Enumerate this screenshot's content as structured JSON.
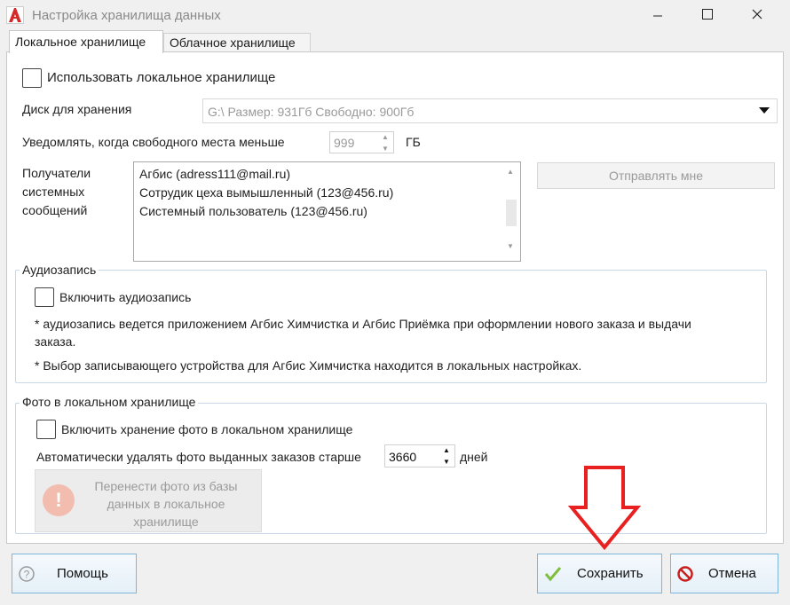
{
  "window": {
    "title": "Настройка хранилища данных",
    "app_icon": "agbis-logo-icon",
    "controls": {
      "minimize": "minimize-icon",
      "maximize": "maximize-icon",
      "close": "close-icon"
    }
  },
  "tabs": [
    {
      "label": "Локальное хранилище",
      "active": true
    },
    {
      "label": "Облачное хранилище",
      "active": false
    }
  ],
  "local": {
    "use_local_label": "Использовать локальное хранилище",
    "use_local_checked": false,
    "disk_label": "Диск для хранения",
    "disk_value": "G:\\ Размер: 931Гб Свободно: 900Гб",
    "notify_label": "Уведомлять, когда свободного места меньше",
    "notify_value": "999",
    "notify_unit": "ГБ",
    "recipients_label_1": "Получатели",
    "recipients_label_2": "системных",
    "recipients_label_3": "сообщений",
    "recipients": [
      "Агбис (adress111@mail.ru)",
      "Сотрудик цеха вымышленный (123@456.ru)",
      "Системный пользователь (123@456.ru)"
    ],
    "send_me_label": "Отправлять мне"
  },
  "audio": {
    "group_title": "Аудиозапись",
    "enable_label": "Включить аудиозапись",
    "enable_checked": false,
    "note1_line1": "* аудиозапись ведется приложением Агбис Химчистка и Агбис Приёмка при оформлении нового заказа и выдачи",
    "note1_line2": "заказа.",
    "note2": "* Выбор записывающего устройства для Агбис Химчистка находится в локальных настройках."
  },
  "photo": {
    "group_title": "Фото в локальном хранилище",
    "enable_label": "Включить хранение фото в локальном хранилище",
    "enable_checked": false,
    "autodelete_label": "Автоматически удалять фото выданных заказов старше",
    "autodelete_value": "3660",
    "autodelete_unit": "дней",
    "move_btn_line1": "Перенести фото из базы",
    "move_btn_line2": "данных в локальное",
    "move_btn_line3": "хранилище"
  },
  "footer": {
    "help_label": "Помощь",
    "save_label": "Сохранить",
    "cancel_label": "Отмена"
  },
  "colors": {
    "annotation_arrow": "#e82020",
    "button_border": "#7fb5d9",
    "group_border": "#c8d8e8"
  }
}
